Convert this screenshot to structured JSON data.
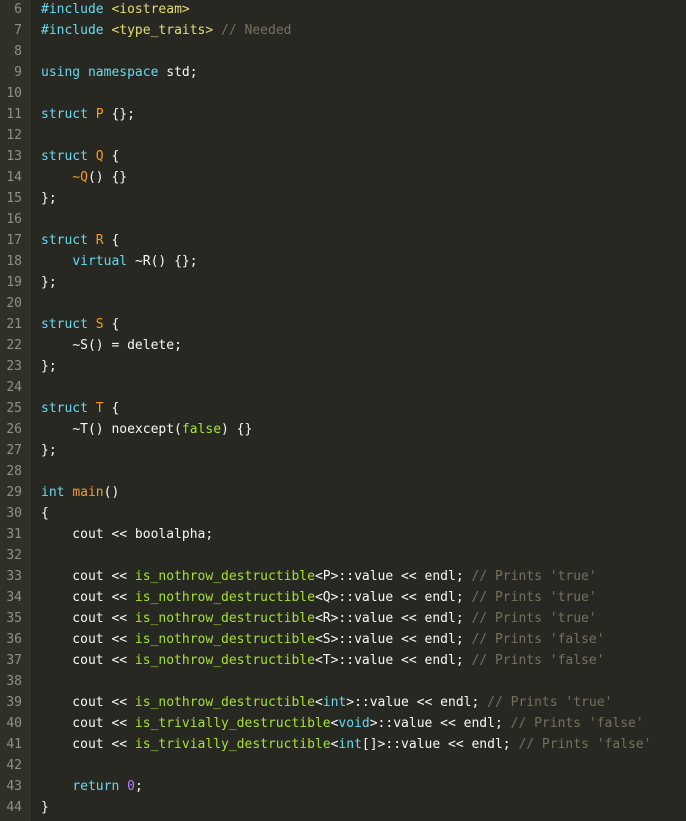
{
  "editor": {
    "language": "cpp",
    "theme": "monokai",
    "colors": {
      "background": "#272822",
      "gutter_background": "#2f3129",
      "line_number": "#90908a",
      "plain": "#f8f8f2",
      "keyword": "#66d9ef",
      "string": "#e6db74",
      "comment": "#75715e",
      "entity": "#a6e22e",
      "number": "#ae81ff",
      "operator": "#f92672",
      "type": "#fd971f"
    },
    "lines": [
      {
        "number": "6",
        "tokens": [
          {
            "t": "#include ",
            "c": "t-kw"
          },
          {
            "t": "<iostream>",
            "c": "t-str"
          }
        ]
      },
      {
        "number": "7",
        "tokens": [
          {
            "t": "#include ",
            "c": "t-kw"
          },
          {
            "t": "<type_traits>",
            "c": "t-str"
          },
          {
            "t": " // Needed",
            "c": "t-cmt"
          }
        ]
      },
      {
        "number": "8",
        "tokens": []
      },
      {
        "number": "9",
        "tokens": [
          {
            "t": "using ",
            "c": "t-kw"
          },
          {
            "t": "namespace ",
            "c": "t-kw"
          },
          {
            "t": "std;",
            "c": "t-plain"
          }
        ]
      },
      {
        "number": "10",
        "tokens": []
      },
      {
        "number": "11",
        "tokens": [
          {
            "t": "struct ",
            "c": "t-kw"
          },
          {
            "t": "P",
            "c": "t-type"
          },
          {
            "t": " {};",
            "c": "t-plain"
          }
        ]
      },
      {
        "number": "12",
        "tokens": []
      },
      {
        "number": "13",
        "tokens": [
          {
            "t": "struct ",
            "c": "t-kw"
          },
          {
            "t": "Q",
            "c": "t-type"
          },
          {
            "t": " {",
            "c": "t-plain"
          }
        ]
      },
      {
        "number": "14",
        "tokens": [
          {
            "t": "    ",
            "c": "t-plain"
          },
          {
            "t": "~Q",
            "c": "t-type"
          },
          {
            "t": "() {}",
            "c": "t-plain"
          }
        ]
      },
      {
        "number": "15",
        "tokens": [
          {
            "t": "};",
            "c": "t-plain"
          }
        ]
      },
      {
        "number": "16",
        "tokens": []
      },
      {
        "number": "17",
        "tokens": [
          {
            "t": "struct ",
            "c": "t-kw"
          },
          {
            "t": "R",
            "c": "t-type"
          },
          {
            "t": " {",
            "c": "t-plain"
          }
        ]
      },
      {
        "number": "18",
        "tokens": [
          {
            "t": "    ",
            "c": "t-plain"
          },
          {
            "t": "virtual ",
            "c": "t-kw"
          },
          {
            "t": "~R",
            "c": "t-plain"
          },
          {
            "t": "() {};",
            "c": "t-plain"
          }
        ]
      },
      {
        "number": "19",
        "tokens": [
          {
            "t": "};",
            "c": "t-plain"
          }
        ]
      },
      {
        "number": "20",
        "tokens": []
      },
      {
        "number": "21",
        "tokens": [
          {
            "t": "struct ",
            "c": "t-kw"
          },
          {
            "t": "S",
            "c": "t-type"
          },
          {
            "t": " {",
            "c": "t-plain"
          }
        ]
      },
      {
        "number": "22",
        "tokens": [
          {
            "t": "    ",
            "c": "t-plain"
          },
          {
            "t": "~S",
            "c": "t-plain"
          },
          {
            "t": "() = ",
            "c": "t-plain"
          },
          {
            "t": "delete",
            "c": "t-plain"
          },
          {
            "t": ";",
            "c": "t-plain"
          }
        ]
      },
      {
        "number": "23",
        "tokens": [
          {
            "t": "};",
            "c": "t-plain"
          }
        ]
      },
      {
        "number": "24",
        "tokens": []
      },
      {
        "number": "25",
        "tokens": [
          {
            "t": "struct ",
            "c": "t-kw"
          },
          {
            "t": "T",
            "c": "t-type"
          },
          {
            "t": " {",
            "c": "t-plain"
          }
        ]
      },
      {
        "number": "26",
        "tokens": [
          {
            "t": "    ",
            "c": "t-plain"
          },
          {
            "t": "~T",
            "c": "t-plain"
          },
          {
            "t": "() noexcept(",
            "c": "t-plain"
          },
          {
            "t": "false",
            "c": "t-ent"
          },
          {
            "t": ") {}",
            "c": "t-plain"
          }
        ]
      },
      {
        "number": "27",
        "tokens": [
          {
            "t": "};",
            "c": "t-plain"
          }
        ]
      },
      {
        "number": "28",
        "tokens": []
      },
      {
        "number": "29",
        "tokens": [
          {
            "t": "int ",
            "c": "t-kw"
          },
          {
            "t": "main",
            "c": "t-type"
          },
          {
            "t": "()",
            "c": "t-plain"
          }
        ]
      },
      {
        "number": "30",
        "tokens": [
          {
            "t": "{",
            "c": "t-plain"
          }
        ]
      },
      {
        "number": "31",
        "tokens": [
          {
            "t": "    cout << boolalpha;",
            "c": "t-plain"
          }
        ]
      },
      {
        "number": "32",
        "tokens": []
      },
      {
        "number": "33",
        "tokens": [
          {
            "t": "    cout << ",
            "c": "t-plain"
          },
          {
            "t": "is_nothrow_destructible",
            "c": "t-ent"
          },
          {
            "t": "<P>::value << endl; ",
            "c": "t-plain"
          },
          {
            "t": "// Prints 'true'",
            "c": "t-cmt"
          }
        ]
      },
      {
        "number": "34",
        "tokens": [
          {
            "t": "    cout << ",
            "c": "t-plain"
          },
          {
            "t": "is_nothrow_destructible",
            "c": "t-ent"
          },
          {
            "t": "<Q>::value << endl; ",
            "c": "t-plain"
          },
          {
            "t": "// Prints 'true'",
            "c": "t-cmt"
          }
        ]
      },
      {
        "number": "35",
        "tokens": [
          {
            "t": "    cout << ",
            "c": "t-plain"
          },
          {
            "t": "is_nothrow_destructible",
            "c": "t-ent"
          },
          {
            "t": "<R>::value << endl; ",
            "c": "t-plain"
          },
          {
            "t": "// Prints 'true'",
            "c": "t-cmt"
          }
        ]
      },
      {
        "number": "36",
        "tokens": [
          {
            "t": "    cout << ",
            "c": "t-plain"
          },
          {
            "t": "is_nothrow_destructible",
            "c": "t-ent"
          },
          {
            "t": "<S>::value << endl; ",
            "c": "t-plain"
          },
          {
            "t": "// Prints 'false'",
            "c": "t-cmt"
          }
        ]
      },
      {
        "number": "37",
        "tokens": [
          {
            "t": "    cout << ",
            "c": "t-plain"
          },
          {
            "t": "is_nothrow_destructible",
            "c": "t-ent"
          },
          {
            "t": "<T>::value << endl; ",
            "c": "t-plain"
          },
          {
            "t": "// Prints 'false'",
            "c": "t-cmt"
          }
        ]
      },
      {
        "number": "38",
        "tokens": []
      },
      {
        "number": "39",
        "tokens": [
          {
            "t": "    cout << ",
            "c": "t-plain"
          },
          {
            "t": "is_nothrow_destructible",
            "c": "t-ent"
          },
          {
            "t": "<",
            "c": "t-plain"
          },
          {
            "t": "int",
            "c": "t-kw"
          },
          {
            "t": ">::value << endl; ",
            "c": "t-plain"
          },
          {
            "t": "// Prints 'true'",
            "c": "t-cmt"
          }
        ]
      },
      {
        "number": "40",
        "tokens": [
          {
            "t": "    cout << ",
            "c": "t-plain"
          },
          {
            "t": "is_trivially_destructible",
            "c": "t-ent"
          },
          {
            "t": "<",
            "c": "t-plain"
          },
          {
            "t": "void",
            "c": "t-kw"
          },
          {
            "t": ">::value << endl; ",
            "c": "t-plain"
          },
          {
            "t": "// Prints 'false'",
            "c": "t-cmt"
          }
        ]
      },
      {
        "number": "41",
        "tokens": [
          {
            "t": "    cout << ",
            "c": "t-plain"
          },
          {
            "t": "is_trivially_destructible",
            "c": "t-ent"
          },
          {
            "t": "<",
            "c": "t-plain"
          },
          {
            "t": "int",
            "c": "t-kw"
          },
          {
            "t": "[]>::value << endl; ",
            "c": "t-plain"
          },
          {
            "t": "// Prints 'false'",
            "c": "t-cmt"
          }
        ]
      },
      {
        "number": "42",
        "tokens": []
      },
      {
        "number": "43",
        "tokens": [
          {
            "t": "    ",
            "c": "t-plain"
          },
          {
            "t": "return ",
            "c": "t-kw"
          },
          {
            "t": "0",
            "c": "t-num"
          },
          {
            "t": ";",
            "c": "t-plain"
          }
        ]
      },
      {
        "number": "44",
        "tokens": [
          {
            "t": "}",
            "c": "t-plain"
          }
        ]
      }
    ]
  }
}
